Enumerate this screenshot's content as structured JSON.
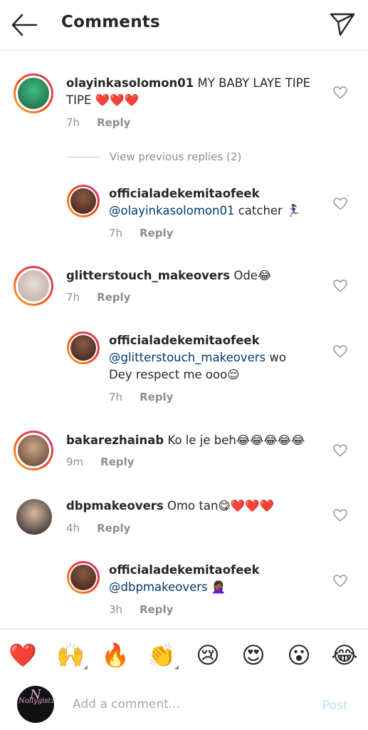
{
  "header": {
    "title": "Comments"
  },
  "comments": [
    {
      "username": "olayinkasolomon01",
      "text": " MY BABY LAYE TIPE",
      "text2": "TIPE ❤️❤️❤️",
      "time": "7h",
      "reply": "Reply",
      "avatar_color": "#2f7a5a"
    },
    {
      "username": "officialadekemitaofeek",
      "mention": "@olayinkasolomon01",
      "text": " catcher 🏃🏾‍♀️",
      "time": "7h",
      "reply": "Reply",
      "avatar_color": "#6b3a2a"
    },
    {
      "username": "glitterstouch_makeovers",
      "text": " Ode😂",
      "time": "7h",
      "reply": "Reply",
      "avatar_color": "#c9b8b0"
    },
    {
      "username": "officialadekemitaofeek",
      "mention": "@glitterstouch_makeovers",
      "text": " wo",
      "text2": "Dey respect me ooo😌",
      "time": "7h",
      "reply": "Reply",
      "avatar_color": "#6b3a2a"
    },
    {
      "username": "bakarezhainab",
      "text": " Ko le je beh😂😂😂😂😂",
      "time": "9m",
      "reply": "Reply",
      "avatar_color": "#8a6f5c"
    },
    {
      "username": "dbpmakeovers",
      "text": " Omo tan😋❤️❤️❤️",
      "time": "4h",
      "reply": "Reply",
      "avatar_color": "#3b2a22"
    },
    {
      "username": "officialadekemitaofeek",
      "mention": "@dbpmakeovers",
      "text": " 🤦🏾‍♀️",
      "time": "3h",
      "reply": "Reply",
      "avatar_color": "#6b3a2a"
    }
  ],
  "view_previous": "View previous replies (2)",
  "emoji_bar": [
    "❤️",
    "🙌",
    "🔥",
    "👏",
    "😢",
    "😍",
    "😮",
    "😂"
  ],
  "composer": {
    "placeholder": "Add a comment...",
    "post_label": "Post",
    "avatar_logo": "Nollygistz",
    "avatar_letter": "N"
  },
  "colors": {
    "link": "#00376b",
    "post_disabled": "#b2dffc",
    "muted": "#8e8e8e"
  }
}
